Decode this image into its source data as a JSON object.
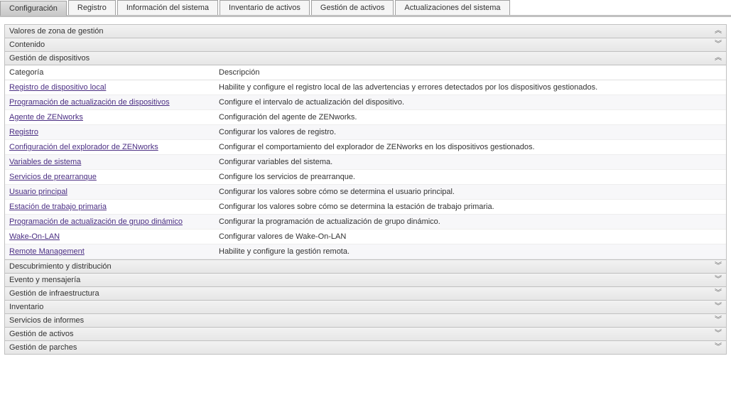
{
  "tabs": [
    {
      "label": "Configuración",
      "active": true
    },
    {
      "label": "Registro",
      "active": false
    },
    {
      "label": "Información del sistema",
      "active": false
    },
    {
      "label": "Inventario de activos",
      "active": false
    },
    {
      "label": "Gestión de activos",
      "active": false
    },
    {
      "label": "Actualizaciones del sistema",
      "active": false
    }
  ],
  "sections_top": [
    {
      "title": "Valores de zona de gestión",
      "expanded": true
    },
    {
      "title": "Contenido",
      "expanded": false
    },
    {
      "title": "Gestión de dispositivos",
      "expanded": true
    }
  ],
  "table": {
    "headers": {
      "category": "Categoría",
      "description": "Descripción"
    },
    "rows": [
      {
        "category": "Registro de dispositivo local",
        "description": "Habilite y configure el registro local de las advertencias y errores detectados por los dispositivos gestionados."
      },
      {
        "category": "Programación de actualización de dispositivos",
        "description": "Configure el intervalo de actualización del dispositivo."
      },
      {
        "category": "Agente de ZENworks",
        "description": "Configuración del agente de ZENworks."
      },
      {
        "category": "Registro",
        "description": "Configurar los valores de registro."
      },
      {
        "category": "Configuración del explorador de ZENworks",
        "description": "Configurar el comportamiento del explorador de ZENworks en los dispositivos gestionados."
      },
      {
        "category": "Variables de sistema",
        "description": "Configurar variables del sistema."
      },
      {
        "category": "Servicios de prearranque",
        "description": "Configure los servicios de prearranque."
      },
      {
        "category": "Usuario principal",
        "description": "Configurar los valores sobre cómo se determina el usuario principal."
      },
      {
        "category": "Estación de trabajo primaria",
        "description": "Configurar los valores sobre cómo se determina la estación de trabajo primaria."
      },
      {
        "category": "Programación de actualización de grupo dinámico",
        "description": "Configurar la programación de actualización de grupo dinámico."
      },
      {
        "category": "Wake-On-LAN",
        "description": "Configurar valores de Wake-On-LAN"
      },
      {
        "category": "Remote Management",
        "description": "Habilite y configure la gestión remota."
      }
    ]
  },
  "sections_bottom": [
    {
      "title": "Descubrimiento y distribución",
      "expanded": false
    },
    {
      "title": "Evento y mensajería",
      "expanded": false
    },
    {
      "title": "Gestión de infraestructura",
      "expanded": false
    },
    {
      "title": "Inventario",
      "expanded": false
    },
    {
      "title": "Servicios de informes",
      "expanded": false
    },
    {
      "title": "Gestión de activos",
      "expanded": false
    },
    {
      "title": "Gestión de parches",
      "expanded": false
    }
  ],
  "icons": {
    "expanded": "︽",
    "collapsed": "︾"
  }
}
